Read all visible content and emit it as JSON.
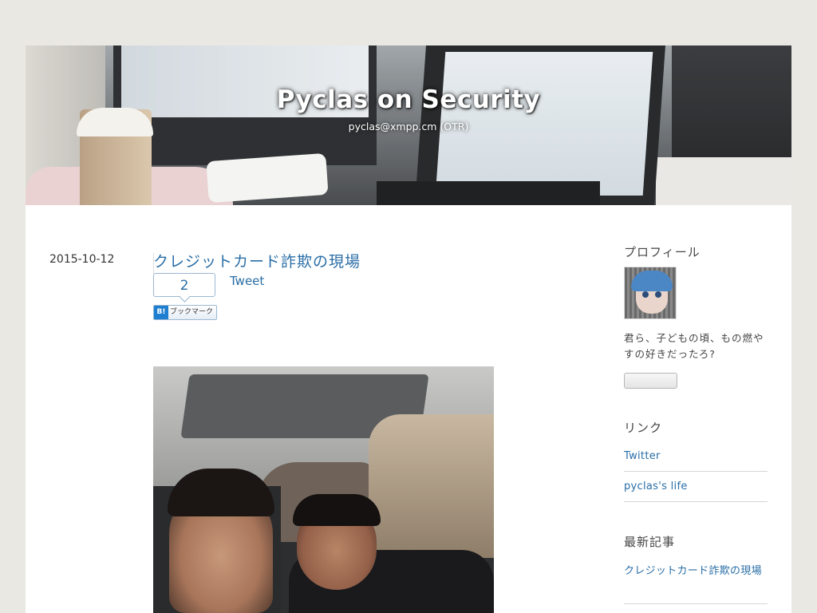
{
  "header": {
    "title": "Pyclas on Security",
    "subtitle": "pyclas@xmpp.cm (OTR)"
  },
  "entry": {
    "date": "2015-10-12",
    "title": "クレジットカード詐欺の現場",
    "bookmark_count": "2",
    "bookmark_label": "ブックマーク",
    "bookmark_icon": "B!",
    "tweet_label": "Tweet"
  },
  "sidebar": {
    "profile_heading": "プロフィール",
    "profile_text": "君ら、子どもの頃、もの燃やすの好きだったろ?",
    "links_heading": "リンク",
    "links": [
      {
        "label": "Twitter"
      },
      {
        "label": "pyclas's life"
      }
    ],
    "recent_heading": "最新記事",
    "recent": [
      {
        "label": "クレジットカード詐欺の現場"
      }
    ]
  },
  "colors": {
    "page_bg": "#e9e8e3",
    "content_bg": "#ffffff",
    "link": "#2a6ea6",
    "hatena_blue": "#1e7fd0"
  }
}
